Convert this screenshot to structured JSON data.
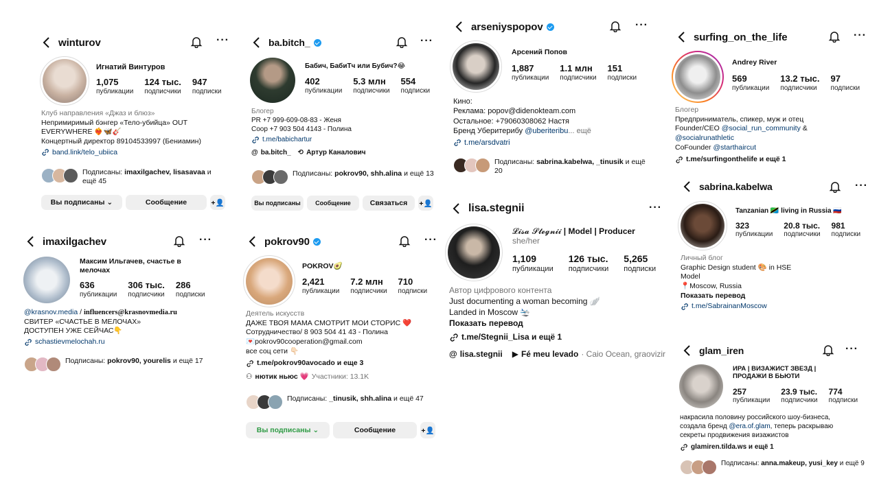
{
  "cards": {
    "winturov": {
      "username": "winturov",
      "fullname": "Игнатий Винтуров",
      "stats": [
        {
          "n": "1,075",
          "l": "публикации"
        },
        {
          "n": "124 тыс.",
          "l": "подписчики"
        },
        {
          "n": "947",
          "l": "подписки"
        }
      ],
      "bio": [
        "Клуб направления «Джаз и блюз»",
        "Непримиримый бэнгер «Тело-убийца» OUT",
        "EVERYWHERE ❤️‍🔥🦋🎸",
        "Концертный директор 89104533997 (Бениамин)"
      ],
      "link": "band.link/telo_ubiica",
      "mutual_prefix": "Подписаны: ",
      "mutual_names": "imaxilgachev, lisasavaa",
      "mutual_suffix": " и ещё 45",
      "btn_following": "Вы подписаны ⌄",
      "btn_message": "Сообщение"
    },
    "babitch": {
      "username": "ba.bitch_",
      "fullname": "Бабич, БабиТч или Бубич?😂",
      "stats": [
        {
          "n": "402",
          "l": "публикации"
        },
        {
          "n": "5.3 млн",
          "l": "подписчики"
        },
        {
          "n": "554",
          "l": "подписки"
        }
      ],
      "category": "Блогер",
      "bio": [
        "PR +7 999-609-08-83 - Женя",
        "Coop +7 903 504 4143 - Полина"
      ],
      "link": "t.me/babichartur",
      "threads": "ba.bitch_",
      "linked": "Артур Каналович",
      "mutual_prefix": "Подписаны: ",
      "mutual_names": "pokrov90, shh.alina",
      "mutual_suffix": " и ещё 13",
      "btn_following": "Вы подписаны",
      "btn_message": "Сообщение",
      "btn_contact": "Связаться"
    },
    "arseniy": {
      "username": "arseniyspopov",
      "fullname": "Арсений Попов",
      "stats": [
        {
          "n": "1,887",
          "l": "публикации"
        },
        {
          "n": "1.1 млн",
          "l": "подписчики"
        },
        {
          "n": "151",
          "l": "подписки"
        }
      ],
      "bio": [
        "Кино:",
        "Реклама: popov@didenokteam.com",
        "Остальное: +79060308062 Настя"
      ],
      "bio_brand": "Бренд Уберитерибу ",
      "bio_brand_link": "@uberiteribu",
      "bio_more": "... ещё",
      "link": "t.me/arsdvatri",
      "mutual_prefix": "Подписаны: ",
      "mutual_names": "sabrina.kabelwa, _tinusik",
      "mutual_suffix": " и ещё 20"
    },
    "surfing": {
      "username": "surfing_on_the_life",
      "fullname": "Andrey River",
      "stats": [
        {
          "n": "569",
          "l": "публикации"
        },
        {
          "n": "13.2 тыс.",
          "l": "подписчики"
        },
        {
          "n": "97",
          "l": "подписки"
        }
      ],
      "category": "Блогер",
      "bio1": "Предприниматель, спикер, муж и отец",
      "bio2_pre": "Founder/CEO ",
      "bio2_link": "@social_run_community",
      "bio2_post": " &",
      "bio3_link": "@socialrunathletic",
      "bio4_pre": "CoFounder ",
      "bio4_link": "@starthaircut",
      "link": "t.me/surfingonthelife и ещё 1"
    },
    "imaxil": {
      "username": "imaxilgachev",
      "fullname": "Максим Ильгачев, счастье в мелочах",
      "stats": [
        {
          "n": "636",
          "l": "публикации"
        },
        {
          "n": "306 тыс.",
          "l": "подписчики"
        },
        {
          "n": "286",
          "l": "подписки"
        }
      ],
      "bio1_link": "@krasnov.media",
      "bio1_sep": " / ",
      "bio1_bold": "influencers@krasnovmedia.ru",
      "bio2": "СВИТЕР «СЧАСТЬЕ В МЕЛОЧАХ»",
      "bio3": "ДОСТУПЕН УЖЕ СЕЙЧАС👇",
      "link": "schastievmelochah.ru",
      "mutual_prefix": "Подписаны: ",
      "mutual_names": "pokrov90, yourelis",
      "mutual_suffix": " и ещё 17"
    },
    "pokrov": {
      "username": "pokrov90",
      "fullname": "POKROV🥑",
      "stats": [
        {
          "n": "2,421",
          "l": "публикации"
        },
        {
          "n": "7.2 млн",
          "l": "подписчики"
        },
        {
          "n": "710",
          "l": "подписки"
        }
      ],
      "category": "Деятель искусств",
      "bio": [
        "ДАЖЕ ТВОЯ МАМА СМОТРИТ МОИ СТОРИС ❤️",
        "Сотрудничество/ 8 903 504 41 43 - Полина",
        "💌pokrov90cooperation@gmail.com",
        "все соц сети 👇🏻"
      ],
      "link": "t.me/pokrov90avocado и еще 3",
      "channel": "нютик ньюс 💗",
      "channel_members": "Участники: 13.1K",
      "mutual_prefix": "Подписаны: ",
      "mutual_names": "_tinusik, shh.alina",
      "mutual_suffix": " и ещё 47",
      "btn_following": "Вы подписаны ⌄",
      "btn_message": "Сообщение"
    },
    "lisa": {
      "username": "lisa.stegnii",
      "fullname_script": "𝓛𝓲𝓼𝓪 𝓢𝓽𝓮𝓰𝓷𝓲𝓲",
      "fullname_rest": " | Model | Producer",
      "pronouns": " she/her",
      "stats": [
        {
          "n": "1,109",
          "l": "публикации"
        },
        {
          "n": "126 тыс.",
          "l": "подписчики"
        },
        {
          "n": "5,265",
          "l": "подписки"
        }
      ],
      "category": "Автор цифрового контента",
      "bio": [
        "Just documenting a woman becoming 🪽",
        "Landed in Moscow 🛬"
      ],
      "translate": "Показать перевод",
      "link": "t.me/Stegnii_Lisa и ещё 1",
      "threads": "lisa.stegnii",
      "music": "Fé meu levado",
      "music_artist": " · Caio Ocean, graovizir"
    },
    "sabrina": {
      "username": "sabrina.kabelwa",
      "fullname": "Tanzanian 🇹🇿 living in Russia 🇷🇺",
      "stats": [
        {
          "n": "323",
          "l": "публикации"
        },
        {
          "n": "20.8 тыс.",
          "l": "подписчики"
        },
        {
          "n": "981",
          "l": "подписки"
        }
      ],
      "category": "Личный блог",
      "bio": [
        "Graphic Design student 🎨 in HSE",
        "Model",
        "📍Moscow, Russia"
      ],
      "translate": "Показать перевод",
      "link": "t.me/SabrainanMoscow"
    },
    "glam": {
      "username": "glam_iren",
      "fullname": "ИРА | ВИЗАЖИСТ ЗВЕЗД | ПРОДАЖИ В БЬЮТИ",
      "stats": [
        {
          "n": "257",
          "l": "публикации"
        },
        {
          "n": "23.9 тыс.",
          "l": "подписчики"
        },
        {
          "n": "774",
          "l": "подписки"
        }
      ],
      "bio1": "накрасила половину российского шоу-бизнеса,",
      "bio2_pre": "создала бренд ",
      "bio2_link": "@era.of.glam",
      "bio2_post": ", теперь раскрываю",
      "bio3": "секреты продвижения визажистов",
      "link": "glamiren.tilda.ws и ещё 1",
      "mutual_prefix": "Подписаны: ",
      "mutual_names": "anna.makeup, yusi_key",
      "mutual_suffix": " и ещё 9"
    }
  },
  "colors": {
    "link": "#00376b",
    "verified": "#1d9bf0",
    "muted": "#737373",
    "button": "#efefef",
    "following_green": "#2d9a43"
  }
}
